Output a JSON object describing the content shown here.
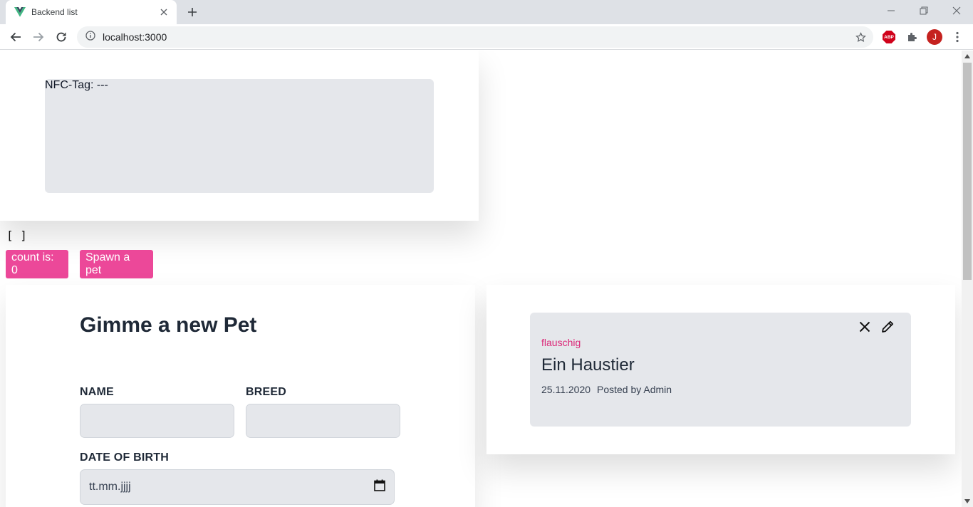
{
  "browser": {
    "tab_title": "Backend list",
    "url": "localhost:3000",
    "profile_initial": "J",
    "extension_abp_label": "ABP"
  },
  "nfc": {
    "label": "NFC-Tag: ---"
  },
  "debug": {
    "array_text": "[ ]"
  },
  "buttons": {
    "count_label": "count is: 0",
    "spawn_label": "Spawn a pet"
  },
  "form": {
    "title": "Gimme a new Pet",
    "name_label": "NAME",
    "name_value": "",
    "breed_label": "BREED",
    "breed_value": "",
    "dob_label": "DATE OF BIRTH",
    "dob_placeholder": "tt.mm.jjjj"
  },
  "pets": [
    {
      "tag": "flauschig",
      "name": "Ein Haustier",
      "date": "25.11.2020",
      "posted_by": "Posted by Admin"
    }
  ],
  "colors": {
    "accent_pink": "#ec4899",
    "tag_pink": "#db2777",
    "card_gray": "#e5e7eb"
  }
}
